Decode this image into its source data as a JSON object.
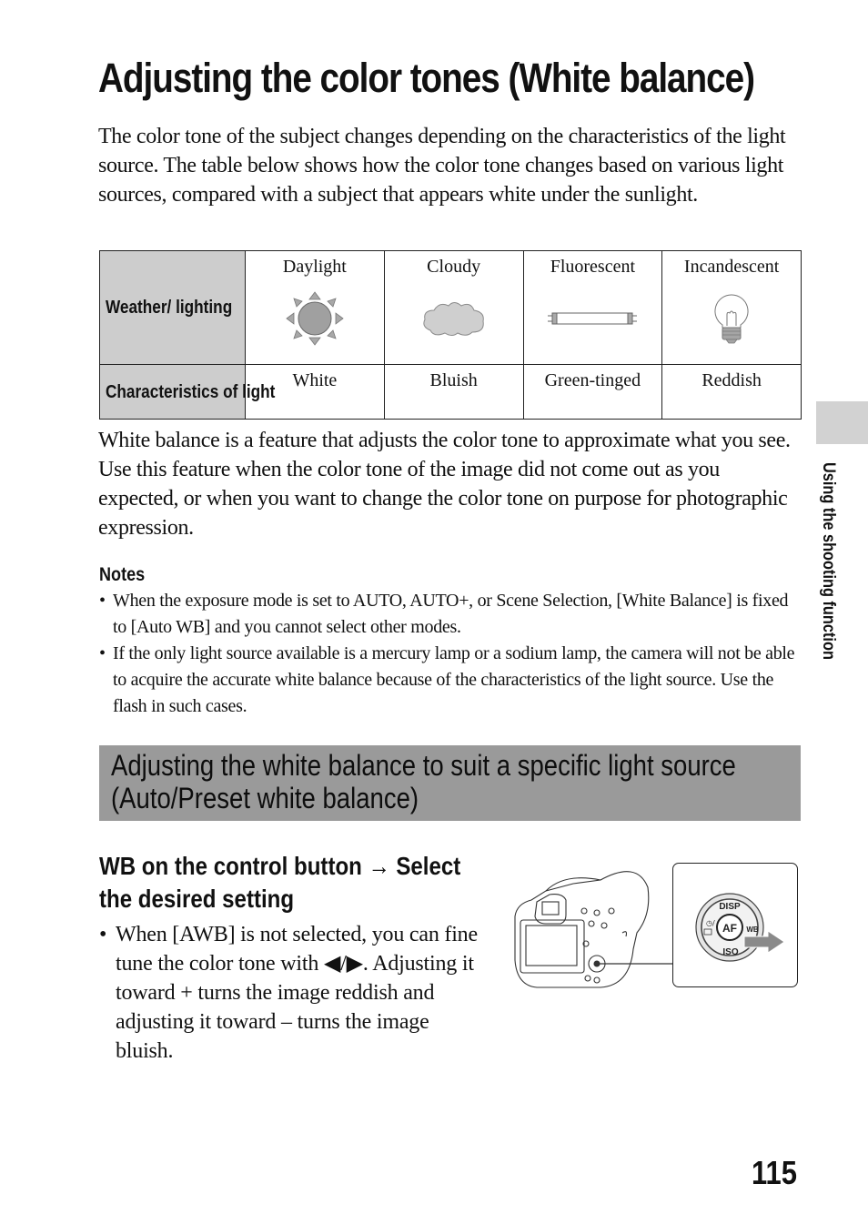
{
  "page": {
    "title": "Adjusting the color tones (White balance)",
    "intro": "The color tone of the subject changes depending on the characteristics of the light source. The table below shows how the color tone changes based on various light sources, compared with a subject that appears white under the sunlight.",
    "page_number": "115",
    "side_tab_label": "Using the shooting function"
  },
  "table": {
    "row_headers": [
      "Weather/ lighting",
      "Characteristics of light"
    ],
    "columns": [
      {
        "label": "Daylight",
        "icon": "sun-icon",
        "characteristic": "White"
      },
      {
        "label": "Cloudy",
        "icon": "cloud-icon",
        "characteristic": "Bluish"
      },
      {
        "label": "Fluorescent",
        "icon": "fluorescent-tube-icon",
        "characteristic": "Green-tinged"
      },
      {
        "label": "Incandescent",
        "icon": "light-bulb-icon",
        "characteristic": "Reddish"
      }
    ]
  },
  "description": "White balance is a feature that adjusts the color tone to approximate what you see. Use this feature when the color tone of the image did not come out as you expected, or when you want to change the color tone on purpose for photographic expression.",
  "notes": {
    "title": "Notes",
    "items": [
      "When the exposure mode is set to AUTO, AUTO+, or Scene Selection, [White Balance] is fixed to [Auto WB] and you cannot select other modes.",
      "If the only light source available is a mercury lamp or a sodium lamp, the camera will not be able to acquire the accurate white balance because of the characteristics of the light source. Use the flash in such cases."
    ]
  },
  "section": {
    "heading": "Adjusting the white balance to suit a specific light source (Auto/Preset white balance)",
    "step_title": "WB on the control button → Select the desired setting",
    "step_bullet": "When [AWB] is not selected, you can fine tune the color tone with ◀/▶. Adjusting it toward + turns the image reddish and adjusting it toward – turns the image bluish."
  },
  "illustration": {
    "dial_labels": {
      "top": "DISP",
      "center": "AF",
      "right": "WB",
      "bottom": "ISO"
    }
  },
  "bullet_char": "•"
}
